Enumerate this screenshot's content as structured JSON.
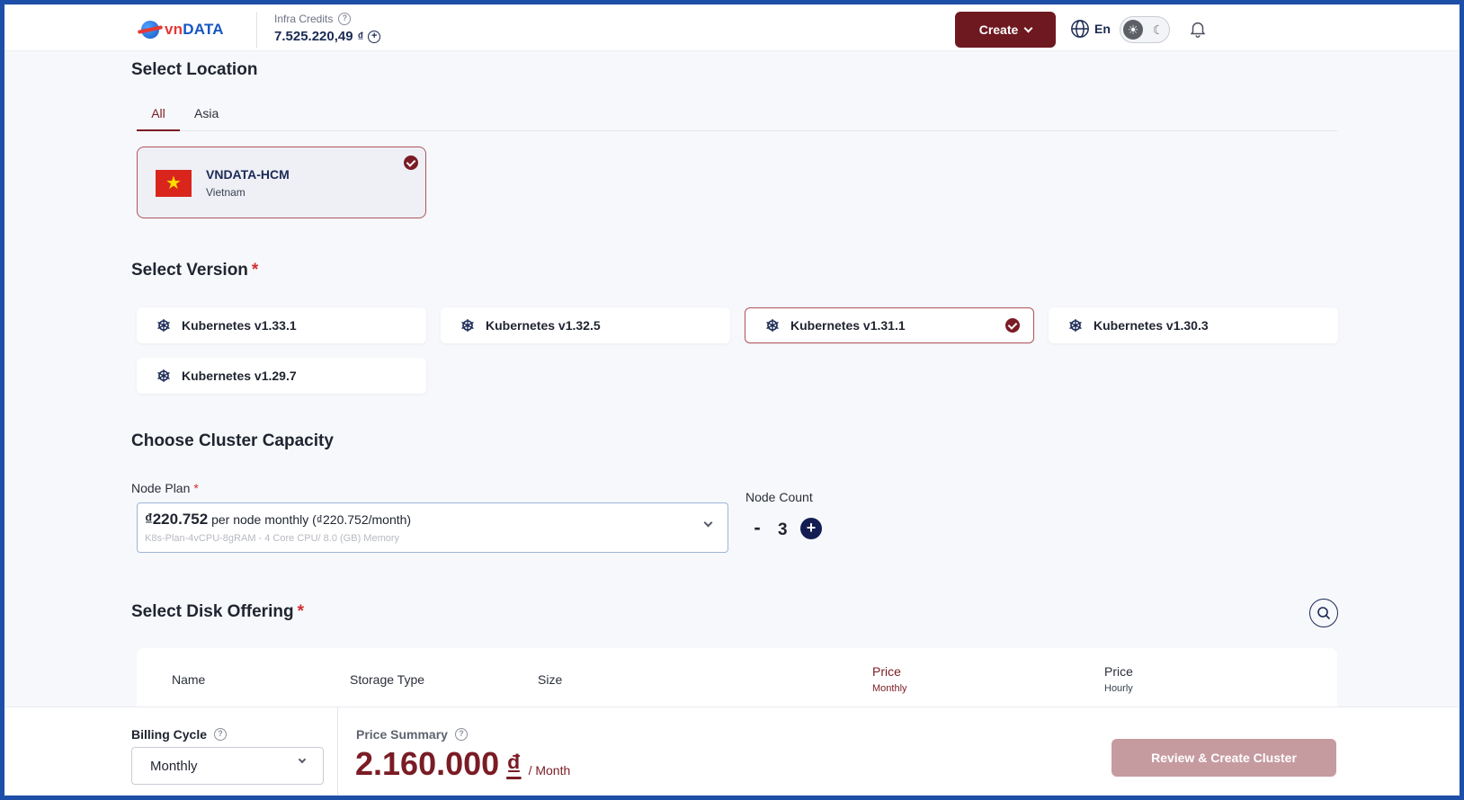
{
  "header": {
    "logo_text_v": "vn",
    "logo_text_rest": "DATA",
    "credits_label": "Infra Credits",
    "credits_value": "7.525.220,49",
    "credits_currency": "₫",
    "create_label": "Create",
    "language": "En"
  },
  "location": {
    "title": "Select Location",
    "tabs": [
      {
        "label": "All",
        "active": true
      },
      {
        "label": "Asia",
        "active": false
      }
    ],
    "cards": [
      {
        "name": "VNDATA-HCM",
        "country": "Vietnam",
        "selected": true
      }
    ]
  },
  "version": {
    "title": "Select Version",
    "required_mark": "*",
    "options": [
      {
        "label": "Kubernetes v1.33.1",
        "selected": false
      },
      {
        "label": "Kubernetes v1.32.5",
        "selected": false
      },
      {
        "label": "Kubernetes v1.31.1",
        "selected": true
      },
      {
        "label": "Kubernetes v1.30.3",
        "selected": false
      },
      {
        "label": "Kubernetes v1.29.7",
        "selected": false
      }
    ]
  },
  "capacity": {
    "title": "Choose Cluster Capacity",
    "node_plan_label": "Node Plan",
    "required_mark": "*",
    "plan_price": "₫220.752",
    "plan_price_suffix": "per node monthly (₫220.752/month)",
    "plan_description": "K8s-Plan-4vCPU-8gRAM - 4 Core CPU/ 8.0 (GB) Memory",
    "node_count_label": "Node Count",
    "minus": "-",
    "node_count": "3",
    "plus": "+"
  },
  "disk": {
    "title": "Select Disk Offering",
    "required_mark": "*",
    "columns": {
      "name": "Name",
      "storage_type": "Storage Type",
      "size": "Size",
      "price_monthly": "Price",
      "price_monthly_sub": "Monthly",
      "price_hourly": "Price",
      "price_hourly_sub": "Hourly"
    }
  },
  "footer": {
    "billing_cycle_label": "Billing Cycle",
    "billing_cycle_value": "Monthly",
    "price_summary_label": "Price Summary",
    "price_value": "2.160.000",
    "price_currency": "₫",
    "price_period": "/ Month",
    "review_label": "Review & Create Cluster"
  },
  "colors": {
    "accent": "#7a1c25",
    "create_button": "#6e1820",
    "review_button_disabled": "#c59ba0",
    "navy": "#131d52"
  }
}
